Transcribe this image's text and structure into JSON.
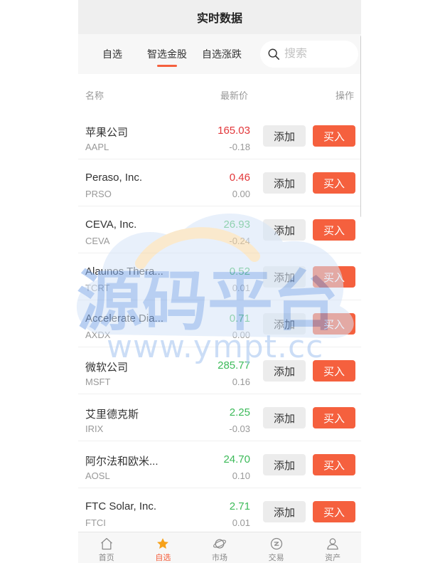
{
  "header": {
    "title": "实时数据"
  },
  "tabs": [
    {
      "label": "自选",
      "active": false
    },
    {
      "label": "智选金股",
      "active": true
    },
    {
      "label": "自选涨跌",
      "active": false
    }
  ],
  "search": {
    "placeholder": "搜索",
    "icon": "search-icon"
  },
  "columns": {
    "name": "名称",
    "price": "最新价",
    "action": "操作"
  },
  "stocks": [
    {
      "name": "苹果公司",
      "code": "AAPL",
      "price": "165.03",
      "change": "-0.18",
      "trend": "up",
      "add_label": "添加",
      "buy_label": "买入"
    },
    {
      "name": "Peraso, Inc.",
      "code": "PRSO",
      "price": "0.46",
      "change": "0.00",
      "trend": "up",
      "add_label": "添加",
      "buy_label": "买入"
    },
    {
      "name": "CEVA, Inc.",
      "code": "CEVA",
      "price": "26.93",
      "change": "-0.24",
      "trend": "down",
      "add_label": "添加",
      "buy_label": "买入"
    },
    {
      "name": "Alaunos Thera...",
      "code": "TCRT",
      "price": "0.52",
      "change": "0.01",
      "trend": "down",
      "add_label": "添加",
      "buy_label": "买入"
    },
    {
      "name": "Accelerate Dia...",
      "code": "AXDX",
      "price": "0.71",
      "change": "0.00",
      "trend": "down",
      "add_label": "添加",
      "buy_label": "买入"
    },
    {
      "name": "微软公司",
      "code": "MSFT",
      "price": "285.77",
      "change": "0.16",
      "trend": "down",
      "add_label": "添加",
      "buy_label": "买入"
    },
    {
      "name": "艾里德克斯",
      "code": "IRIX",
      "price": "2.25",
      "change": "-0.03",
      "trend": "down",
      "add_label": "添加",
      "buy_label": "买入"
    },
    {
      "name": "阿尔法和欧米...",
      "code": "AOSL",
      "price": "24.70",
      "change": "0.10",
      "trend": "down",
      "add_label": "添加",
      "buy_label": "买入"
    },
    {
      "name": "FTC Solar, Inc.",
      "code": "FTCI",
      "price": "2.71",
      "change": "0.01",
      "trend": "down",
      "add_label": "添加",
      "buy_label": "买入"
    }
  ],
  "nav": [
    {
      "label": "首页",
      "icon": "home-icon",
      "active": false
    },
    {
      "label": "自选",
      "icon": "star-icon",
      "active": true
    },
    {
      "label": "市场",
      "icon": "planet-icon",
      "active": false
    },
    {
      "label": "交易",
      "icon": "exchange-icon",
      "active": false
    },
    {
      "label": "资产",
      "icon": "user-icon",
      "active": false
    }
  ],
  "watermark": {
    "text": "源码平台",
    "url": "www.ympt.cc"
  },
  "colors": {
    "accent": "#f5603e",
    "up": "#e2373a",
    "down": "#3cba59",
    "topbar": "#efefef"
  }
}
